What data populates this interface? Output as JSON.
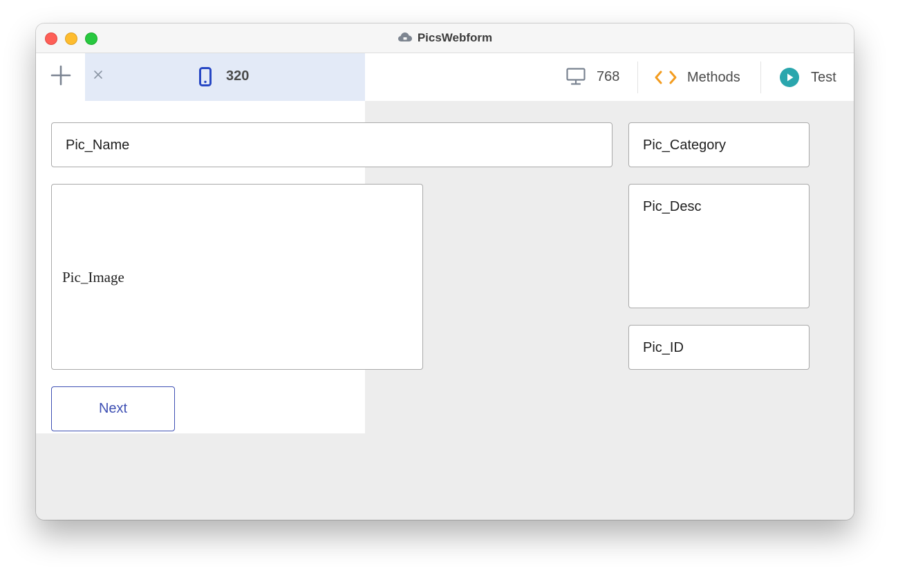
{
  "window": {
    "title": "PicsWebform",
    "title_icon": "cloud-icon"
  },
  "toolbar": {
    "add_icon": "plus-icon",
    "active_tab": {
      "close_icon": "close-icon",
      "device_icon": "mobile-phone-icon",
      "label": "320"
    },
    "desktop": {
      "icon": "desktop-monitor-icon",
      "label": "768"
    },
    "methods": {
      "icon": "code-brackets-icon",
      "label": "Methods"
    },
    "test": {
      "icon": "play-circle-icon",
      "label": "Test"
    }
  },
  "form": {
    "fields": {
      "pic_name": "Pic_Name",
      "pic_image": "Pic_Image",
      "pic_category": "Pic_Category",
      "pic_desc": "Pic_Desc",
      "pic_id": "Pic_ID"
    },
    "next_button": "Next"
  },
  "colors": {
    "active_tab_bg": "#e3eaf7",
    "accent_blue": "#3d4fb3",
    "methods_orange": "#f39c1f",
    "test_teal": "#2aa6ad",
    "canvas_bg": "#ededed"
  }
}
